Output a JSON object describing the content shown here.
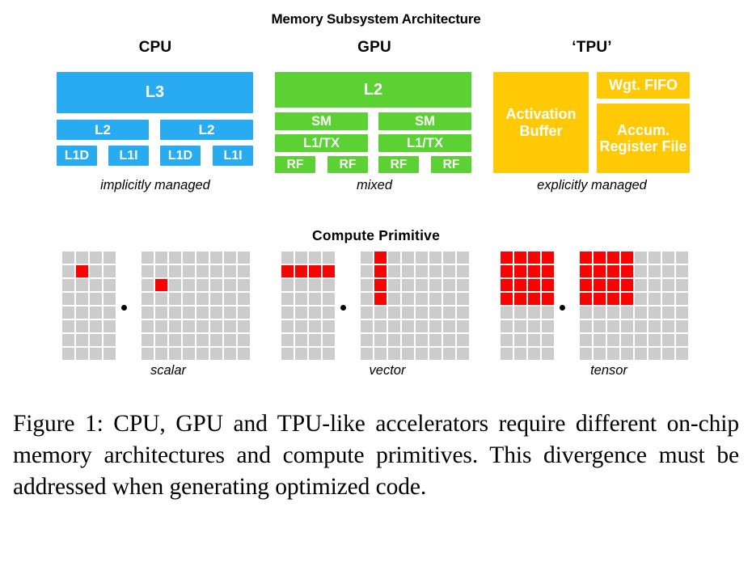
{
  "figure": {
    "memory_title": "Memory Subsystem Architecture",
    "compute_title": "Compute  Primitive",
    "caption": "Figure 1: CPU, GPU and TPU-like accelerators require different on-chip memory architectures and compute primitives. This divergence must be addressed when generating optimized code."
  },
  "columns": {
    "cpu": {
      "title": "CPU",
      "caption": "implicitly managed",
      "color": "#29ABF2",
      "blocks": {
        "l3": "L3",
        "l2_left": "L2",
        "l2_right": "L2",
        "l1d_0": "L1D",
        "l1i_0": "L1I",
        "l1d_1": "L1D",
        "l1i_1": "L1I"
      }
    },
    "gpu": {
      "title": "GPU",
      "caption": "mixed",
      "color": "#5CD134",
      "blocks": {
        "l2": "L2",
        "sm_0": "SM",
        "sm_1": "SM",
        "l1tx_0": "L1/TX",
        "l1tx_1": "L1/TX",
        "rf_0": "RF",
        "rf_1": "RF",
        "rf_2": "RF",
        "rf_3": "RF"
      }
    },
    "tpu": {
      "title": "‘TPU’",
      "caption": "explicitly managed",
      "color": "#FFC905",
      "blocks": {
        "activation_buffer": "Activation Buffer",
        "wgt_fifo": "Wgt. FIFO",
        "accum_register_file": "Accum. Register File"
      }
    }
  },
  "compute_primitives": {
    "scalar": {
      "label": "scalar",
      "operator": "·",
      "operand_a": {
        "cols": 4,
        "rows": 8,
        "highlighted": [
          [
            1,
            1
          ]
        ]
      },
      "operand_b": {
        "cols": 8,
        "rows": 8,
        "highlighted": [
          [
            2,
            1
          ]
        ]
      }
    },
    "vector": {
      "label": "vector",
      "operator": "·",
      "operand_a": {
        "cols": 4,
        "rows": 8,
        "highlighted": [
          [
            1,
            0
          ],
          [
            1,
            1
          ],
          [
            1,
            2
          ],
          [
            1,
            3
          ]
        ]
      },
      "operand_b": {
        "cols": 8,
        "rows": 8,
        "highlighted": [
          [
            0,
            1
          ],
          [
            1,
            1
          ],
          [
            2,
            1
          ],
          [
            3,
            1
          ]
        ]
      }
    },
    "tensor": {
      "label": "tensor",
      "operator": "·",
      "operand_a": {
        "cols": 4,
        "rows": 8,
        "highlighted": [
          [
            0,
            0
          ],
          [
            0,
            1
          ],
          [
            0,
            2
          ],
          [
            0,
            3
          ],
          [
            1,
            0
          ],
          [
            1,
            1
          ],
          [
            1,
            2
          ],
          [
            1,
            3
          ],
          [
            2,
            0
          ],
          [
            2,
            1
          ],
          [
            2,
            2
          ],
          [
            2,
            3
          ],
          [
            3,
            0
          ],
          [
            3,
            1
          ],
          [
            3,
            2
          ],
          [
            3,
            3
          ]
        ]
      },
      "operand_b": {
        "cols": 8,
        "rows": 8,
        "highlighted": [
          [
            0,
            0
          ],
          [
            0,
            1
          ],
          [
            0,
            2
          ],
          [
            0,
            3
          ],
          [
            1,
            0
          ],
          [
            1,
            1
          ],
          [
            1,
            2
          ],
          [
            1,
            3
          ],
          [
            2,
            0
          ],
          [
            2,
            1
          ],
          [
            2,
            2
          ],
          [
            2,
            3
          ],
          [
            3,
            0
          ],
          [
            3,
            1
          ],
          [
            3,
            2
          ],
          [
            3,
            3
          ]
        ]
      }
    }
  },
  "colors": {
    "cell_idle": "#CCCCCC",
    "cell_active": "#FF0000",
    "background": "#FFFFFF",
    "text": "#000000"
  }
}
